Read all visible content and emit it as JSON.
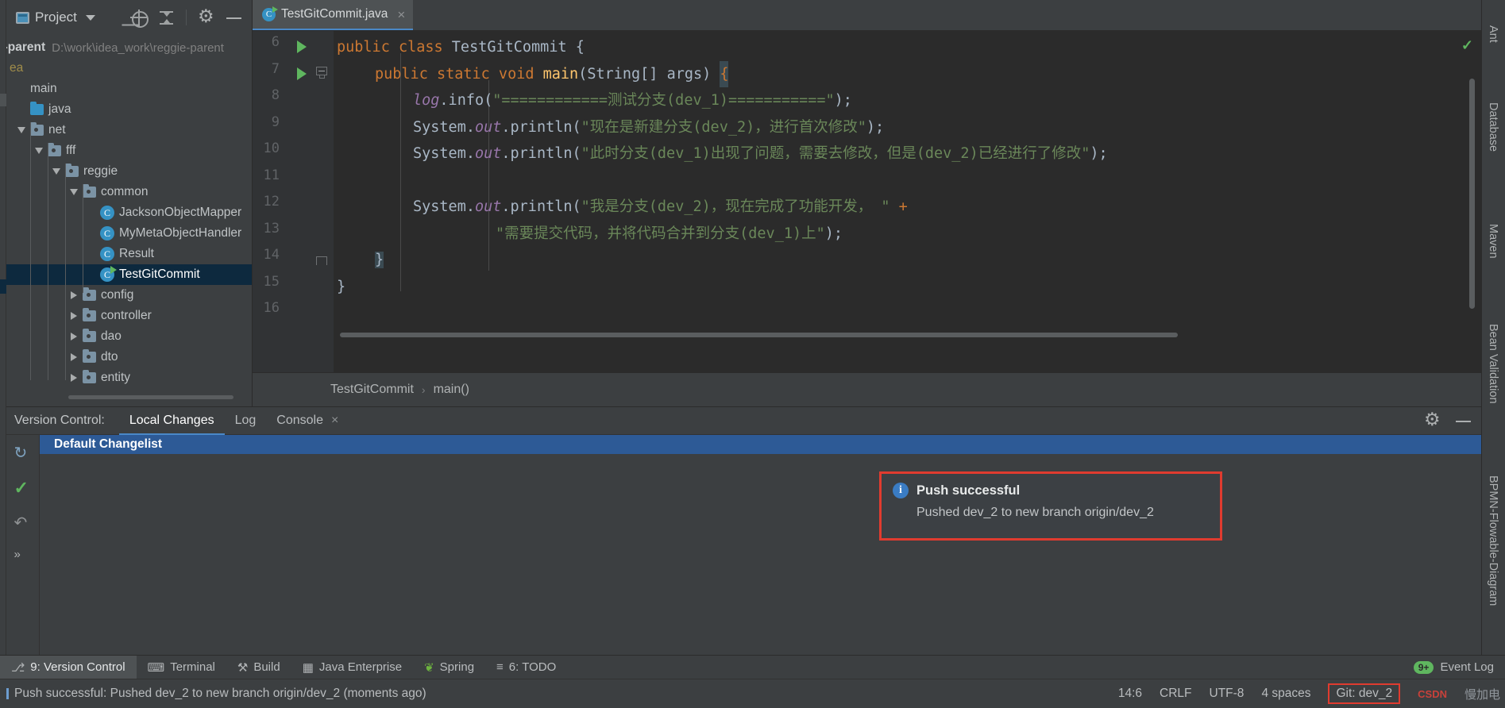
{
  "project_panel": {
    "title": "Project",
    "icons": [
      "project-view-icon",
      "locate-icon",
      "collapse-all-icon",
      "settings-gear-icon",
      "hide-icon"
    ],
    "root_name": "e-parent",
    "root_path": "D:\\work\\idea_work\\reggie-parent",
    "idea_folder": "ea",
    "tree": [
      {
        "label": "main",
        "indent": 0,
        "twisty": "none",
        "icon": "none",
        "selected": false
      },
      {
        "label": "java",
        "indent": 0,
        "twisty": "none",
        "icon": "folder-blue",
        "selected": false
      },
      {
        "label": "net",
        "indent": 0,
        "twisty": "expanded",
        "icon": "folder",
        "selected": false
      },
      {
        "label": "fff",
        "indent": 1,
        "twisty": "expanded",
        "icon": "folder",
        "selected": false
      },
      {
        "label": "reggie",
        "indent": 2,
        "twisty": "expanded",
        "icon": "folder",
        "selected": false
      },
      {
        "label": "common",
        "indent": 3,
        "twisty": "expanded",
        "icon": "folder",
        "selected": false
      },
      {
        "label": "JacksonObjectMapper",
        "indent": 4,
        "twisty": "none",
        "icon": "class",
        "selected": false
      },
      {
        "label": "MyMetaObjectHandler",
        "indent": 4,
        "twisty": "none",
        "icon": "class",
        "selected": false
      },
      {
        "label": "Result",
        "indent": 4,
        "twisty": "none",
        "icon": "class",
        "selected": false
      },
      {
        "label": "TestGitCommit",
        "indent": 4,
        "twisty": "none",
        "icon": "class-run",
        "selected": true
      },
      {
        "label": "config",
        "indent": 3,
        "twisty": "collapsed",
        "icon": "folder",
        "selected": false
      },
      {
        "label": "controller",
        "indent": 3,
        "twisty": "collapsed",
        "icon": "folder",
        "selected": false
      },
      {
        "label": "dao",
        "indent": 3,
        "twisty": "collapsed",
        "icon": "folder",
        "selected": false
      },
      {
        "label": "dto",
        "indent": 3,
        "twisty": "collapsed",
        "icon": "folder",
        "selected": false
      },
      {
        "label": "entity",
        "indent": 3,
        "twisty": "collapsed",
        "icon": "folder",
        "selected": false
      }
    ]
  },
  "editor": {
    "tab": {
      "label": "TestGitCommit.java",
      "close": "×",
      "icon": "java-class-run-icon"
    },
    "inspection_status": "✓",
    "lines": [
      {
        "num": "6",
        "run_marker": true,
        "fold": "none"
      },
      {
        "num": "7",
        "run_marker": true,
        "fold": "start"
      },
      {
        "num": "8",
        "run_marker": false,
        "fold": "none"
      },
      {
        "num": "9",
        "run_marker": false,
        "fold": "none"
      },
      {
        "num": "10",
        "run_marker": false,
        "fold": "none"
      },
      {
        "num": "11",
        "run_marker": false,
        "fold": "none"
      },
      {
        "num": "12",
        "run_marker": false,
        "fold": "none"
      },
      {
        "num": "13",
        "run_marker": false,
        "fold": "none"
      },
      {
        "num": "14",
        "run_marker": false,
        "fold": "end"
      },
      {
        "num": "15",
        "run_marker": false,
        "fold": "none"
      },
      {
        "num": "16",
        "run_marker": false,
        "fold": "none"
      }
    ],
    "code": {
      "l6_kw": "public class",
      "l6_cls": "TestGitCommit",
      "l6_brace": "{",
      "l7_kw": "public static void",
      "l7_name": "main",
      "l7_args": "(String[] args)",
      "l7_brace": "{",
      "l8_var": "log",
      "l8_call": ".info(",
      "l8_str": "\"============测试分支(dev_1)===========\"",
      "l8_end": ");",
      "l9_pre": "System.",
      "l9_field": "out",
      "l9_call": ".println(",
      "l9_str": "\"现在是新建分支(dev_2)，进行首次修改\"",
      "l9_end": ");",
      "l10_pre": "System.",
      "l10_field": "out",
      "l10_call": ".println(",
      "l10_str": "\"此时分支(dev_1)出现了问题，需要去修改，但是(dev_2)已经进行了修改\"",
      "l10_end": ");",
      "l12_pre": "System.",
      "l12_field": "out",
      "l12_call": ".println(",
      "l12_str": "\"我是分支(dev_2)，现在完成了功能开发， \"",
      "l12_plus": "+",
      "l13_str": "\"需要提交代码，并将代码合并到分支(dev_1)上\"",
      "l13_end": ");",
      "l14_brace": "}",
      "l15_brace": "}"
    },
    "breadcrumb": {
      "class": "TestGitCommit",
      "sep": "›",
      "method": "main()"
    }
  },
  "right_toolbar": {
    "items": [
      {
        "label": "Ant",
        "icon": "ant-icon"
      },
      {
        "label": "Database",
        "icon": "database-icon"
      },
      {
        "label": "Maven",
        "icon": "maven-icon"
      },
      {
        "label": "Bean Validation",
        "icon": "bean-validation-icon"
      },
      {
        "label": "BPMN-Flowable-Diagram",
        "icon": "diagram-icon"
      }
    ]
  },
  "version_control": {
    "title": "Version Control:",
    "tabs": [
      {
        "label": "Local Changes",
        "active": true,
        "closable": false
      },
      {
        "label": "Log",
        "active": false,
        "closable": false
      },
      {
        "label": "Console",
        "active": false,
        "closable": true,
        "close": "×"
      }
    ],
    "header_icons": [
      "settings-gear-icon",
      "hide-panel-icon"
    ],
    "sidebar_icons": [
      "refresh-icon",
      "commit-check-icon",
      "rollback-icon",
      "more-icon"
    ],
    "changelist": "Default Changelist"
  },
  "notification": {
    "icon": "info-icon",
    "title": "Push successful",
    "message": "Pushed dev_2 to new branch origin/dev_2",
    "border_color": "#e03b2f"
  },
  "bottom_bar": {
    "items": [
      {
        "label": "9: Version Control",
        "icon": "vcs-icon",
        "active": true,
        "mnemonic": "9"
      },
      {
        "label": "Terminal",
        "icon": "terminal-icon",
        "active": false,
        "mnemonic": ""
      },
      {
        "label": "Build",
        "icon": "build-hammer-icon",
        "active": false,
        "mnemonic": ""
      },
      {
        "label": "Java Enterprise",
        "icon": "java-enterprise-icon",
        "active": false,
        "mnemonic": ""
      },
      {
        "label": "Spring",
        "icon": "spring-leaf-icon",
        "active": false,
        "mnemonic": ""
      },
      {
        "label": "6: TODO",
        "icon": "todo-icon",
        "active": false,
        "mnemonic": "6"
      }
    ],
    "event_log": {
      "label": "Event Log",
      "badge": "9+"
    }
  },
  "status_bar": {
    "message": "Push successful: Pushed dev_2 to new branch origin/dev_2 (moments ago)",
    "caret_position": "14:6",
    "line_separator": "CRLF",
    "encoding": "UTF-8",
    "indent": "4 spaces",
    "git_label": "Git: dev_2",
    "watermark": "慢加电",
    "csdn": "CSDN"
  }
}
